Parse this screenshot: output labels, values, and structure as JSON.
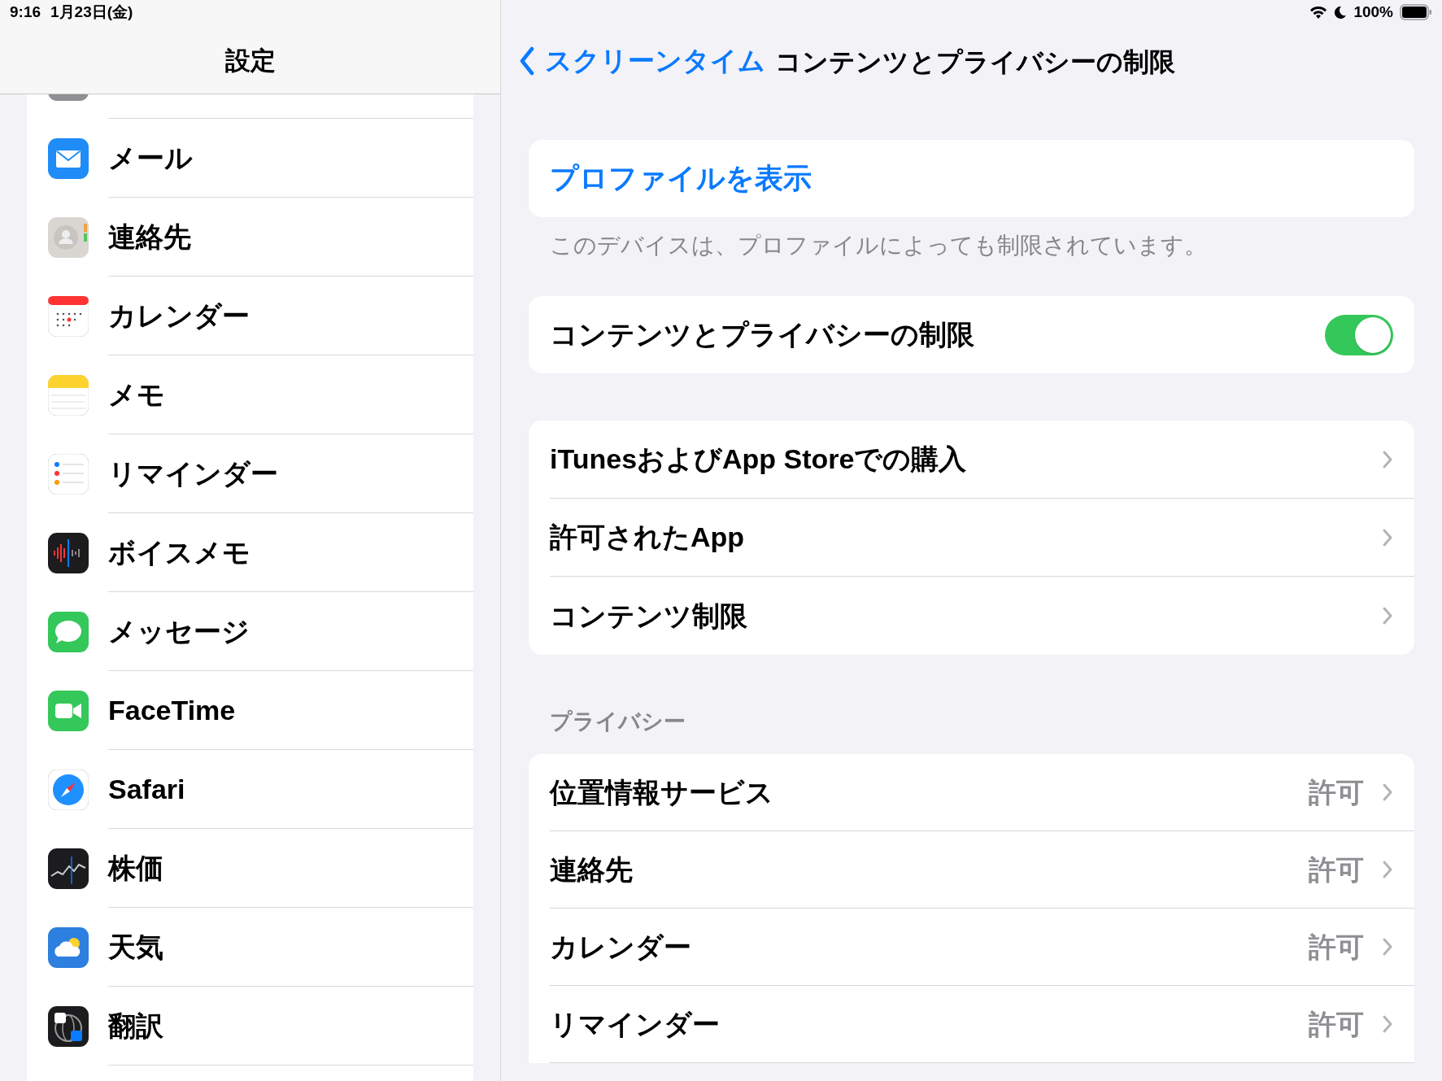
{
  "status_bar": {
    "time": "9:16",
    "date": "1月23日(金)",
    "battery": "100%"
  },
  "sidebar": {
    "title": "設定",
    "items": [
      {
        "label": "メール"
      },
      {
        "label": "連絡先"
      },
      {
        "label": "カレンダー"
      },
      {
        "label": "メモ"
      },
      {
        "label": "リマインダー"
      },
      {
        "label": "ボイスメモ"
      },
      {
        "label": "メッセージ"
      },
      {
        "label": "FaceTime"
      },
      {
        "label": "Safari"
      },
      {
        "label": "株価"
      },
      {
        "label": "天気"
      },
      {
        "label": "翻訳"
      }
    ]
  },
  "nav": {
    "back": "スクリーンタイム",
    "title": "コンテンツとプライバシーの制限"
  },
  "profile": {
    "link": "プロファイルを表示",
    "footer": "このデバイスは、プロファイルによっても制限されています。"
  },
  "restriction_toggle": {
    "label": "コンテンツとプライバシーの制限",
    "on": true
  },
  "store_rows": [
    {
      "label": "iTunesおよびApp Storeでの購入"
    },
    {
      "label": "許可されたApp"
    },
    {
      "label": "コンテンツ制限"
    }
  ],
  "privacy": {
    "header": "プライバシー",
    "rows": [
      {
        "label": "位置情報サービス",
        "value": "許可"
      },
      {
        "label": "連絡先",
        "value": "許可"
      },
      {
        "label": "カレンダー",
        "value": "許可"
      },
      {
        "label": "リマインダー",
        "value": "許可"
      }
    ]
  }
}
